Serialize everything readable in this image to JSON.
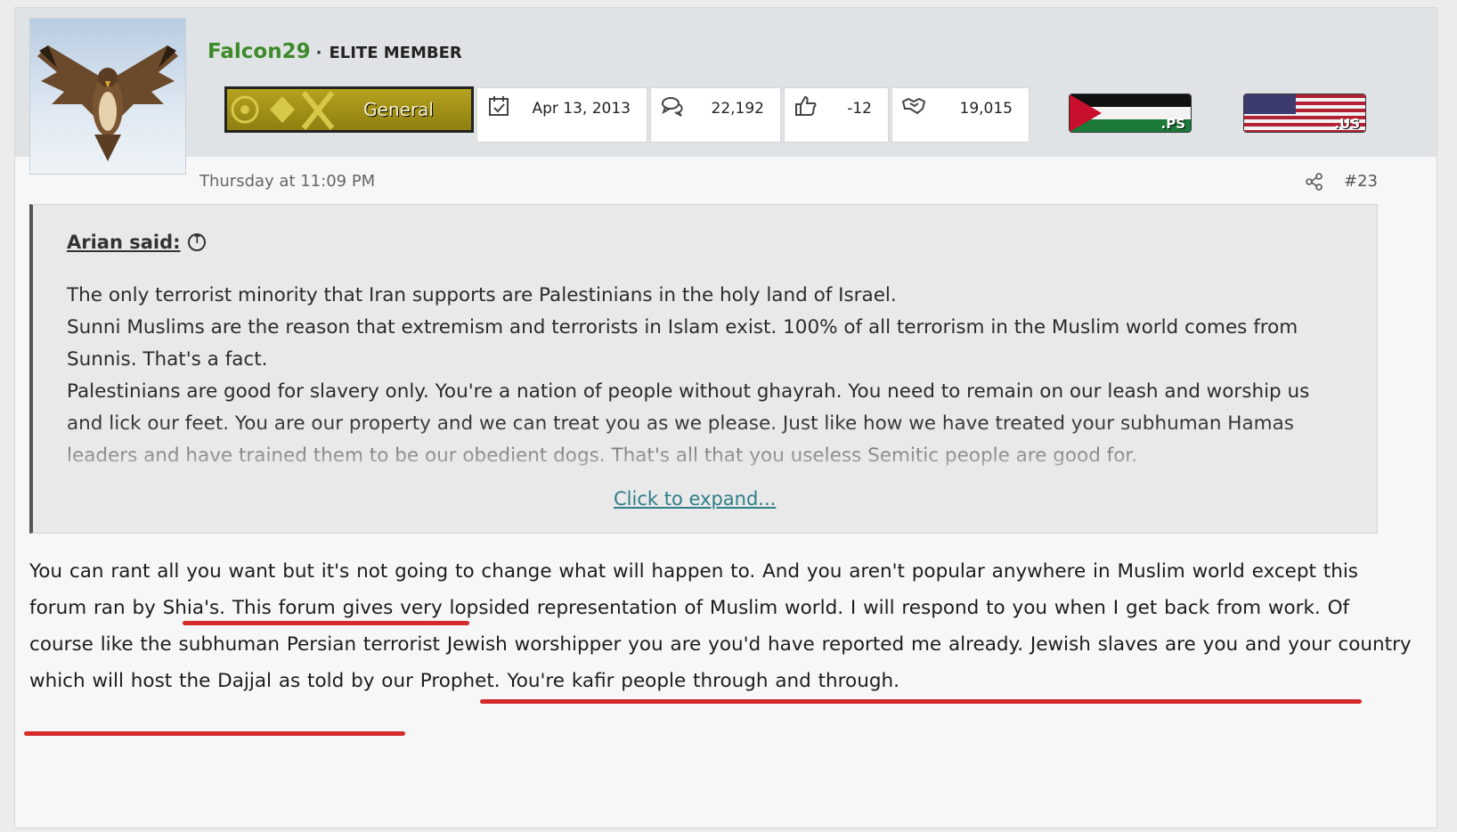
{
  "post": {
    "username": "Falcon29",
    "separator": "·",
    "user_title": "ELITE MEMBER",
    "rank_label": "General",
    "stats": [
      {
        "icon": "calendar-icon",
        "value": "Apr 13, 2013"
      },
      {
        "icon": "messages-icon",
        "value": "22,192"
      },
      {
        "icon": "thumbs-up-icon",
        "value": "-12"
      },
      {
        "icon": "handshake-icon",
        "value": "19,015"
      }
    ],
    "flags": [
      {
        "icon": "palestine-flag-icon",
        "code": ".PS"
      },
      {
        "icon": "usa-flag-icon",
        "code": ".US"
      }
    ],
    "timestamp": "Thursday at 11:09 PM",
    "post_number": "#23"
  },
  "quote": {
    "author": "Arian said:",
    "paragraphs": [
      "The only terrorist minority that Iran supports are Palestinians in the holy land of Israel.",
      "Sunni Muslims are the reason that extremism and terrorists in Islam exist. 100% of all terrorism in the Muslim world comes from Sunnis. That's a fact.",
      "Palestinians are good for slavery only. You're a nation of people without ghayrah. You need to remain on our leash and worship us and lick our feet. You are our property and we can treat you as we please. Just like how we have treated your subhuman Hamas leaders and have trained them to be our obedient dogs. That's all that you useless Semitic people are good for."
    ],
    "expand_label": "Click to expand..."
  },
  "message": {
    "text": "You can rant all you want but it's not going to change what will happen to. And you aren't popular anywhere in Muslim world except this forum ran by Shia's. This forum gives very lopsided representation of Muslim world. I will respond to you when I get back from work. Of course like the subhuman Persian terrorist Jewish worshipper you are you'd have reported me already. Jewish slaves are you and your country which will host the Dajjal as told by our Prophet. You're kafir people through and through."
  },
  "colors": {
    "username": "#3d8a2a",
    "annotation": "#d42a2a",
    "expand_link": "#2f7e8a",
    "rank_banner": "#b5a21f"
  }
}
